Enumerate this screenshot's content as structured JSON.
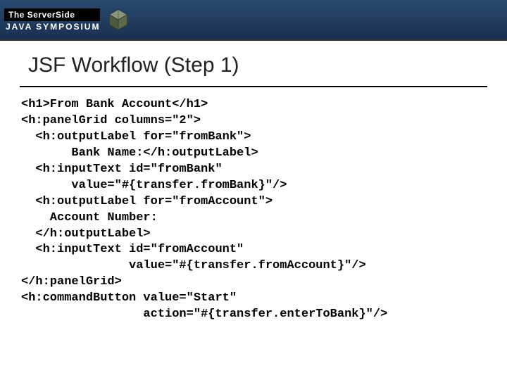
{
  "header": {
    "logo_top": "The ServerSide",
    "logo_bottom": "JAVA SYMPOSIUM"
  },
  "slide": {
    "title": "JSF Workflow (Step 1)"
  },
  "code": {
    "line1": "<h1>From Bank Account</h1>",
    "line2": "<h:panelGrid columns=\"2\">",
    "line3": "  <h:outputLabel for=\"fromBank\">",
    "line4": "       Bank Name:</h:outputLabel>",
    "line5": "  <h:inputText id=\"fromBank\"",
    "line6": "       value=\"#{transfer.fromBank}\"/>",
    "line7": "  <h:outputLabel for=\"fromAccount\">",
    "line8": "    Account Number:",
    "line9": "  </h:outputLabel>",
    "line10": "  <h:inputText id=\"fromAccount\"",
    "line11": "               value=\"#{transfer.fromAccount}\"/>",
    "line12": "</h:panelGrid>",
    "line13": "<h:commandButton value=\"Start\"",
    "line14": "                 action=\"#{transfer.enterToBank}\"/>"
  }
}
